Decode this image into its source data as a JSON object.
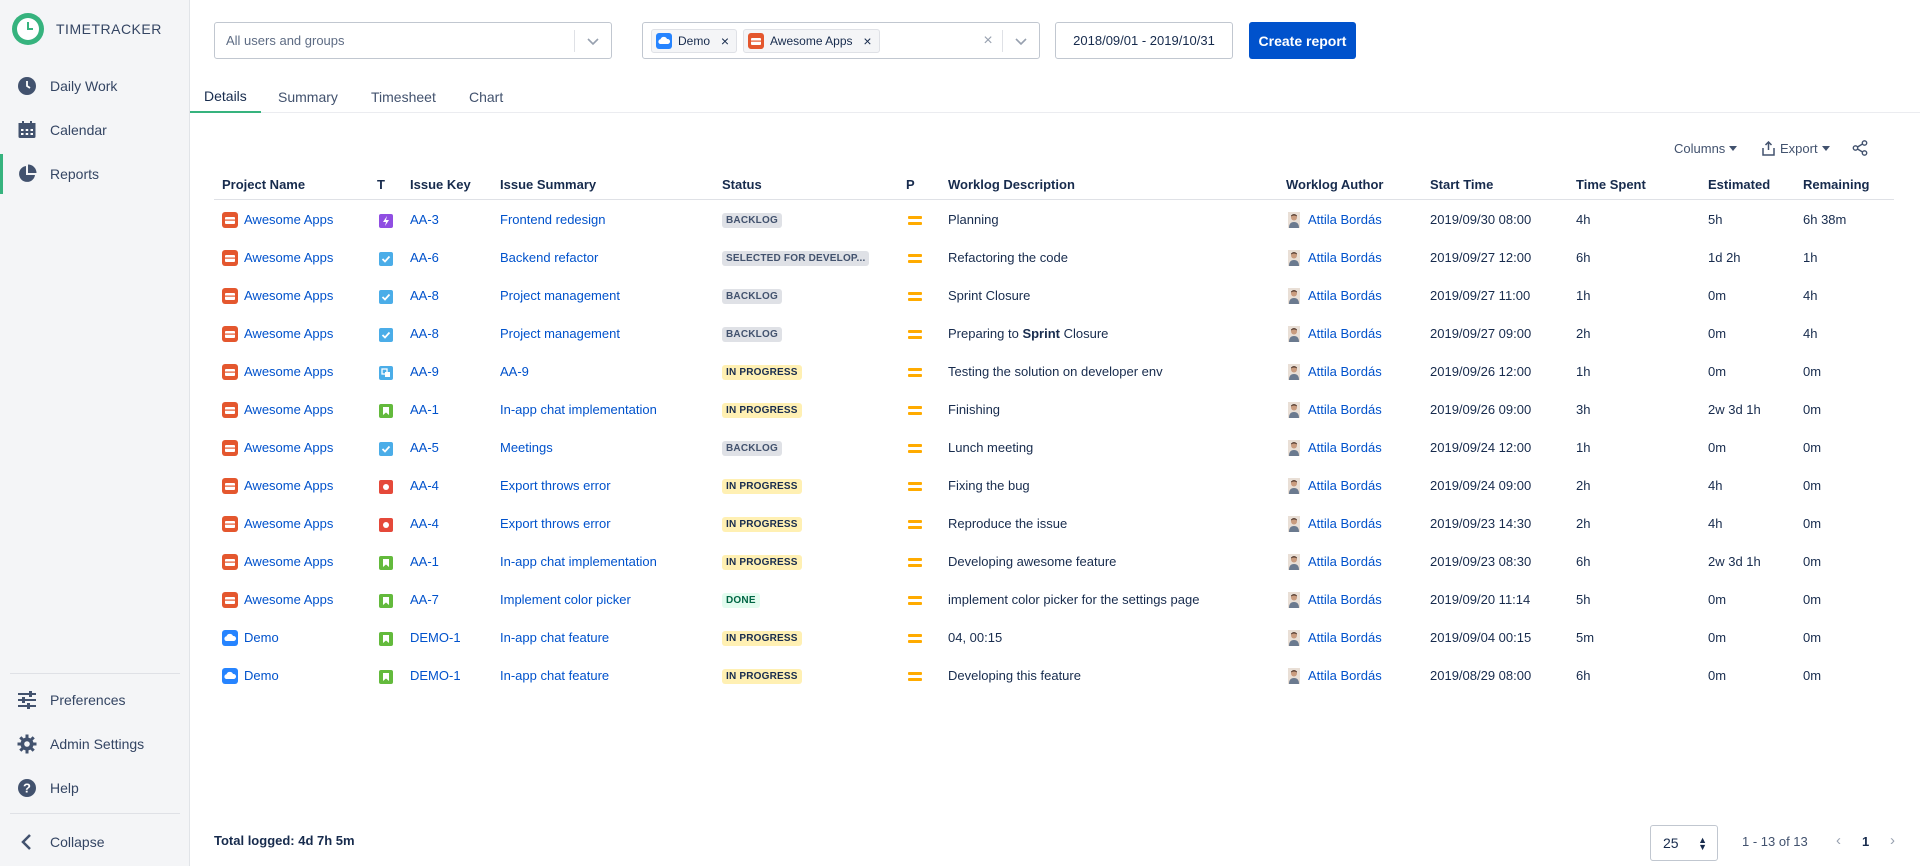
{
  "app": {
    "name": "TIMETRACKER"
  },
  "sidebar": {
    "items": [
      {
        "label": "Daily Work",
        "icon": "clock-icon"
      },
      {
        "label": "Calendar",
        "icon": "calendar-icon"
      },
      {
        "label": "Reports",
        "icon": "pie-chart-icon",
        "active": true
      }
    ],
    "bottom_items": [
      {
        "label": "Preferences",
        "icon": "sliders-icon"
      },
      {
        "label": "Admin Settings",
        "icon": "gear-icon"
      },
      {
        "label": "Help",
        "icon": "help-icon"
      }
    ],
    "collapse_label": "Collapse"
  },
  "filters": {
    "users_placeholder": "All users and groups",
    "projects": [
      "Demo",
      "Awesome Apps"
    ],
    "date_range": "2018/09/01 - 2019/10/31",
    "create_label": "Create report"
  },
  "tabs": [
    "Details",
    "Summary",
    "Timesheet",
    "Chart"
  ],
  "toolbar": {
    "columns_label": "Columns",
    "export_label": "Export"
  },
  "table": {
    "headers": [
      "Project Name",
      "T",
      "Issue Key",
      "Issue Summary",
      "Status",
      "P",
      "Worklog Description",
      "Worklog Author",
      "Start Time",
      "Time Spent",
      "Estimated",
      "Remaining"
    ],
    "rows": [
      {
        "project": "Awesome Apps",
        "type": "epic",
        "key": "AA-3",
        "summary": "Frontend redesign",
        "status": "BACKLOG",
        "status_kind": "backlog",
        "desc": "Planning",
        "author": "Attila Bordás",
        "start": "2019/09/30 08:00",
        "spent": "4h",
        "estimated": "5h",
        "remaining": "6h 38m"
      },
      {
        "project": "Awesome Apps",
        "type": "task",
        "key": "AA-6",
        "summary": "Backend refactor",
        "status": "SELECTED FOR DEVELOP...",
        "status_kind": "selected",
        "desc": "Refactoring the code",
        "author": "Attila Bordás",
        "start": "2019/09/27 12:00",
        "spent": "6h",
        "estimated": "1d 2h",
        "remaining": "1h"
      },
      {
        "project": "Awesome Apps",
        "type": "task",
        "key": "AA-8",
        "summary": "Project management",
        "status": "BACKLOG",
        "status_kind": "backlog",
        "desc": "Sprint Closure",
        "author": "Attila Bordás",
        "start": "2019/09/27 11:00",
        "spent": "1h",
        "estimated": "0m",
        "remaining": "4h"
      },
      {
        "project": "Awesome Apps",
        "type": "task",
        "key": "AA-8",
        "summary": "Project management",
        "status": "BACKLOG",
        "status_kind": "backlog",
        "desc_pre": "Preparing to ",
        "desc_bold": "Sprint",
        "desc_post": " Closure",
        "author": "Attila Bordás",
        "start": "2019/09/27 09:00",
        "spent": "2h",
        "estimated": "0m",
        "remaining": "4h"
      },
      {
        "project": "Awesome Apps",
        "type": "subtask",
        "key": "AA-9",
        "summary": "AA-9",
        "status": "IN PROGRESS",
        "status_kind": "progress",
        "desc": "Testing the solution on developer env",
        "author": "Attila Bordás",
        "start": "2019/09/26 12:00",
        "spent": "1h",
        "estimated": "0m",
        "remaining": "0m"
      },
      {
        "project": "Awesome Apps",
        "type": "story",
        "key": "AA-1",
        "summary": "In-app chat implementation",
        "status": "IN PROGRESS",
        "status_kind": "progress",
        "desc": "Finishing",
        "author": "Attila Bordás",
        "start": "2019/09/26 09:00",
        "spent": "3h",
        "estimated": "2w 3d 1h",
        "remaining": "0m"
      },
      {
        "project": "Awesome Apps",
        "type": "task",
        "key": "AA-5",
        "summary": "Meetings",
        "status": "BACKLOG",
        "status_kind": "backlog",
        "desc": "Lunch meeting",
        "author": "Attila Bordás",
        "start": "2019/09/24 12:00",
        "spent": "1h",
        "estimated": "0m",
        "remaining": "0m"
      },
      {
        "project": "Awesome Apps",
        "type": "bug",
        "key": "AA-4",
        "summary": "Export throws error",
        "status": "IN PROGRESS",
        "status_kind": "progress",
        "desc": "Fixing the bug",
        "author": "Attila Bordás",
        "start": "2019/09/24 09:00",
        "spent": "2h",
        "estimated": "4h",
        "remaining": "0m"
      },
      {
        "project": "Awesome Apps",
        "type": "bug",
        "key": "AA-4",
        "summary": "Export throws error",
        "status": "IN PROGRESS",
        "status_kind": "progress",
        "desc": "Reproduce the issue",
        "author": "Attila Bordás",
        "start": "2019/09/23 14:30",
        "spent": "2h",
        "estimated": "4h",
        "remaining": "0m"
      },
      {
        "project": "Awesome Apps",
        "type": "story",
        "key": "AA-1",
        "summary": "In-app chat implementation",
        "status": "IN PROGRESS",
        "status_kind": "progress",
        "desc": "Developing awesome feature",
        "author": "Attila Bordás",
        "start": "2019/09/23 08:30",
        "spent": "6h",
        "estimated": "2w 3d 1h",
        "remaining": "0m"
      },
      {
        "project": "Awesome Apps",
        "type": "story",
        "key": "AA-7",
        "summary": "Implement color picker",
        "status": "DONE",
        "status_kind": "done",
        "desc": "implement color picker for the settings page",
        "author": "Attila Bordás",
        "start": "2019/09/20 11:14",
        "spent": "5h",
        "estimated": "0m",
        "remaining": "0m"
      },
      {
        "project": "Demo",
        "type": "story",
        "key": "DEMO-1",
        "summary": "In-app chat feature",
        "status": "IN PROGRESS",
        "status_kind": "progress",
        "desc": "04, 00:15",
        "author": "Attila Bordás",
        "start": "2019/09/04 00:15",
        "spent": "5m",
        "estimated": "0m",
        "remaining": "0m"
      },
      {
        "project": "Demo",
        "type": "story",
        "key": "DEMO-1",
        "summary": "In-app chat feature",
        "status": "IN PROGRESS",
        "status_kind": "progress",
        "desc": "Developing this feature",
        "author": "Attila Bordás",
        "start": "2019/08/29 08:00",
        "spent": "6h",
        "estimated": "0m",
        "remaining": "0m"
      }
    ]
  },
  "footer": {
    "total_logged": "Total logged: 4d 7h 5m",
    "page_size": "25",
    "range": "1 - 13 of 13",
    "page": "1"
  },
  "colors": {
    "accent_green": "#36b37e",
    "primary_blue": "#0052cc",
    "priority_medium": "#ffab00"
  }
}
